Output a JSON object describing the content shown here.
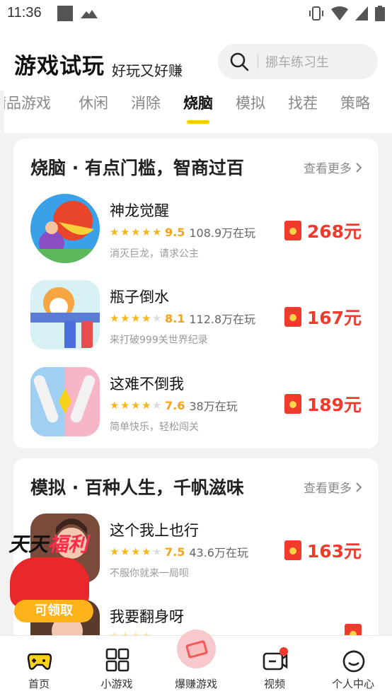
{
  "status_bar": {
    "time": "11:36"
  },
  "header": {
    "title": "游戏试玩",
    "subtitle": "好玩又好赚",
    "search": {
      "placeholder": "挪车练习生"
    }
  },
  "tabs": [
    {
      "label": "精品游戏",
      "active": false
    },
    {
      "label": "休闲",
      "active": false
    },
    {
      "label": "消除",
      "active": false
    },
    {
      "label": "烧脑",
      "active": true
    },
    {
      "label": "模拟",
      "active": false
    },
    {
      "label": "找茬",
      "active": false
    },
    {
      "label": "策略",
      "active": false
    }
  ],
  "sections": [
    {
      "title": "烧脑 · 有点门槛，智商过百",
      "more": "查看更多",
      "games": [
        {
          "name": "神龙觉醒",
          "rating": "9.5",
          "stars": 4.5,
          "players": "108.9万在玩",
          "desc": "消灭巨龙，请求公主",
          "reward": "268元"
        },
        {
          "name": "瓶子倒水",
          "rating": "8.1",
          "stars": 4,
          "players": "112.8万在玩",
          "desc": "来打破999关世界纪录",
          "reward": "167元"
        },
        {
          "name": "这难不倒我",
          "rating": "7.6",
          "stars": 3.5,
          "players": "38万在玩",
          "desc": "简单快乐，轻松闯关",
          "reward": "189元"
        }
      ]
    },
    {
      "title": "模拟 · 百种人生，千帆滋味",
      "more": "查看更多",
      "games": [
        {
          "name": "这个我上也行",
          "rating": "7.5",
          "stars": 3.5,
          "players": "43.6万在玩",
          "desc": "不服你就来一局呗",
          "reward": "163元"
        },
        {
          "name": "我要翻身呀",
          "rating": "",
          "stars": 4,
          "players": "",
          "desc": "",
          "reward": ""
        }
      ]
    }
  ],
  "promo": {
    "title_a": "天天",
    "title_b": "福利",
    "claim": "可领取"
  },
  "nav": [
    {
      "label": "首页"
    },
    {
      "label": "小游戏"
    },
    {
      "label": "爆赚游戏"
    },
    {
      "label": "视频"
    },
    {
      "label": "个人中心"
    }
  ],
  "colors": {
    "accent": "#ffcc00",
    "reward": "#f03b2c",
    "star": "#f6b71a"
  }
}
